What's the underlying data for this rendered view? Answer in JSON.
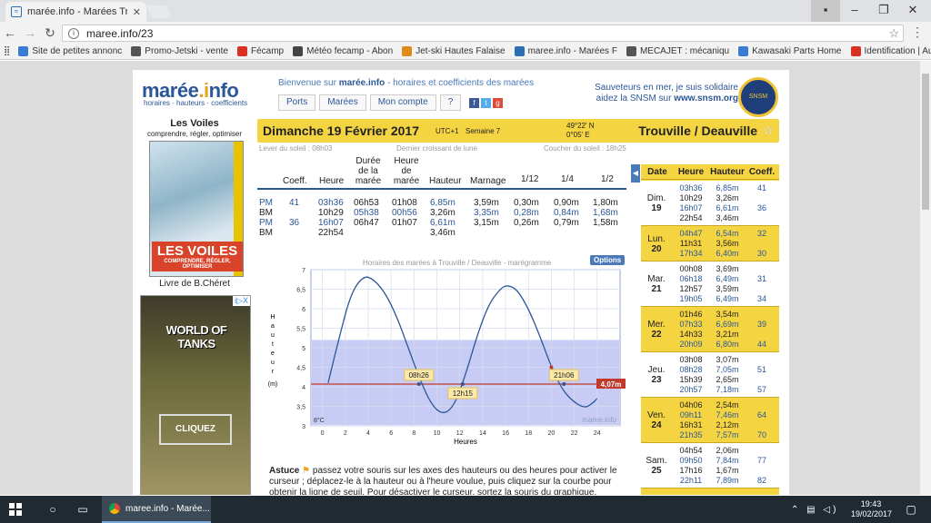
{
  "browser": {
    "tab_title": "marée.info - Marées Trou",
    "url": "maree.info/23",
    "bookmarks": [
      {
        "label": "Site de petites annonc",
        "color": "#3a7bd5"
      },
      {
        "label": "Promo-Jetski - vente",
        "color": "#555"
      },
      {
        "label": "Fécamp",
        "color": "#d93025"
      },
      {
        "label": "Météo fecamp - Abon",
        "color": "#444"
      },
      {
        "label": "Jet-ski Hautes Falaise",
        "color": "#e08a1a"
      },
      {
        "label": "maree.info - Marées F",
        "color": "#2a6fb4"
      },
      {
        "label": "MECAJET : mécaniqu",
        "color": "#555"
      },
      {
        "label": "Kawasaki Parts Home",
        "color": "#3a7bd5"
      },
      {
        "label": "Identification | Autoco",
        "color": "#d93025"
      }
    ]
  },
  "site": {
    "logo_main": "marée",
    "logo_dot": ".",
    "logo_i": "i",
    "logo_rest": "nfo",
    "logo_sub": "horaires · hauteurs · coefficients",
    "welcome_prefix": "Bienvenue sur ",
    "welcome_brand": "marée.info",
    "welcome_suffix": " - horaires et coefficients des marées",
    "nav": [
      "Ports",
      "Marées",
      "Mon compte",
      "?"
    ],
    "snsm_line1": "Sauveteurs en mer, je suis solidaire",
    "snsm_line2_prefix": "aidez la SNSM sur ",
    "snsm_link": "www.snsm.org",
    "snsm_badge": "SNSM"
  },
  "sidebar": {
    "title": "Les Voiles",
    "subtitle": "comprendre, régler, optimiser",
    "book_title": "LES VOILES",
    "book_sub": "COMPRENDRE, RÉGLER, OPTIMISER",
    "book_caption": "Livre de B.Chéret",
    "ad_title": "WORLD OF TANKS",
    "ad_button": "CLIQUEZ",
    "ad_tag": "i▷X"
  },
  "header": {
    "date": "Dimanche 19 Février 2017",
    "utc": "UTC+1",
    "week": "Semaine 7",
    "lat": "49°22' N",
    "lon": "0°05' E",
    "city": "Trouville / Deauville",
    "sunrise": "Lever du soleil : 08h03",
    "moon": "Dernier croissant de lune",
    "sunset": "Coucher du soleil : 18h25"
  },
  "tide_table": {
    "headers": [
      "Coeff.",
      "Heure",
      "Durée de la marée",
      "Heure de marée",
      "Hauteur",
      "Marnage",
      "1/12",
      "1/4",
      "1/2"
    ],
    "rows": [
      {
        "type": "PM",
        "coeff": "41",
        "heure": "03h36",
        "duree": "06h53",
        "heure_maree": "01h08",
        "hauteur": "6,85m",
        "marnage": "3,59m",
        "d12": "0,30m",
        "q": "0,90m",
        "h": "1,80m"
      },
      {
        "type": "BM",
        "coeff": "",
        "heure": "10h29",
        "duree": "05h38",
        "heure_maree": "00h56",
        "hauteur": "3,26m",
        "marnage": "3,35m",
        "d12": "0,28m",
        "q": "0,84m",
        "h": "1,68m"
      },
      {
        "type": "PM",
        "coeff": "36",
        "heure": "16h07",
        "duree": "06h47",
        "heure_maree": "01h07",
        "hauteur": "6,61m",
        "marnage": "3,15m",
        "d12": "0,26m",
        "q": "0,79m",
        "h": "1,58m"
      },
      {
        "type": "BM",
        "coeff": "",
        "heure": "22h54",
        "duree": "",
        "heure_maree": "",
        "hauteur": "3,46m",
        "marnage": "",
        "d12": "",
        "q": "",
        "h": ""
      }
    ]
  },
  "chart_title": "Horaires des marées à Trouville / Deauville - marégramme",
  "options_label": "Options",
  "chart_data": {
    "type": "line",
    "x": [
      0.5,
      1.5,
      2.5,
      3.6,
      4.5,
      5.5,
      6.5,
      7.5,
      8.5,
      9.5,
      10.5,
      11.5,
      12.5,
      13.5,
      14.5,
      15.5,
      16.1,
      17,
      18,
      19,
      20,
      21,
      22,
      22.9,
      23.5,
      24
    ],
    "y": [
      4.1,
      5.3,
      6.4,
      6.85,
      6.75,
      6.4,
      5.8,
      5.0,
      4.2,
      3.55,
      3.28,
      3.5,
      4.3,
      5.3,
      6.1,
      6.5,
      6.61,
      6.5,
      6.0,
      5.3,
      4.5,
      3.9,
      3.6,
      3.46,
      3.55,
      3.7
    ],
    "xlabel": "Heures",
    "ylabel": "Hauteur (m)",
    "xlim": [
      -1,
      26
    ],
    "ylim": [
      3,
      7
    ],
    "xticks": [
      0,
      2,
      4,
      6,
      8,
      10,
      12,
      14,
      16,
      18,
      20,
      22,
      24
    ],
    "yticks": [
      3,
      3.5,
      4,
      4.5,
      5,
      5.5,
      6,
      6.5,
      7
    ],
    "threshold": 4.07,
    "threshold_label": "4,07m",
    "shade_top": 5.2,
    "crossings": [
      {
        "x": 8.43,
        "label": "08h26"
      },
      {
        "x": 12.25,
        "label": "12h15"
      },
      {
        "x": 21.1,
        "label": "21h06"
      }
    ],
    "marker_x": 20,
    "temp_label": "8°C",
    "watermark": "maree.info",
    "line_color": "#2b5797",
    "shade_color": "#c8ccf4",
    "threshold_color": "#c0392b"
  },
  "astuce": {
    "label": "Astuce",
    "text": " passez votre souris sur les axes des hauteurs ou des heures pour activer le curseur ; déplacez-le à la hauteur ou à l'heure voulue, puis cliquez sur la courbe pour obtenir la ligne de seuil. Pour désactiver le curseur, sortez la souris du graphique."
  },
  "week_table": {
    "headers": [
      "Date",
      "Heure",
      "Hauteur",
      "Coeff."
    ],
    "days": [
      {
        "dow": "Dim.",
        "num": "19",
        "highlight": false,
        "tides": [
          [
            "03h36",
            "6,85m",
            "41",
            true
          ],
          [
            "10h29",
            "3,26m",
            "",
            false
          ],
          [
            "16h07",
            "6,61m",
            "36",
            true
          ],
          [
            "22h54",
            "3,46m",
            "",
            false
          ]
        ]
      },
      {
        "dow": "Lun.",
        "num": "20",
        "highlight": true,
        "tides": [
          [
            "04h47",
            "6,54m",
            "32",
            true
          ],
          [
            "11h31",
            "3,56m",
            "",
            false
          ],
          [
            "17h34",
            "6,40m",
            "30",
            true
          ]
        ]
      },
      {
        "dow": "Mar.",
        "num": "21",
        "highlight": false,
        "tides": [
          [
            "00h08",
            "3,69m",
            "",
            false
          ],
          [
            "06h18",
            "6,49m",
            "31",
            true
          ],
          [
            "12h57",
            "3,59m",
            "",
            false
          ],
          [
            "19h05",
            "6,49m",
            "34",
            true
          ]
        ]
      },
      {
        "dow": "Mer.",
        "num": "22",
        "highlight": true,
        "tides": [
          [
            "01h46",
            "3,54m",
            "",
            false
          ],
          [
            "07h33",
            "6,69m",
            "39",
            true
          ],
          [
            "14h33",
            "3,21m",
            "",
            false
          ],
          [
            "20h09",
            "6,80m",
            "44",
            true
          ]
        ]
      },
      {
        "dow": "Jeu.",
        "num": "23",
        "highlight": false,
        "tides": [
          [
            "03h08",
            "3,07m",
            "",
            false
          ],
          [
            "08h28",
            "7,05m",
            "51",
            true
          ],
          [
            "15h39",
            "2,65m",
            "",
            false
          ],
          [
            "20h57",
            "7,18m",
            "57",
            true
          ]
        ]
      },
      {
        "dow": "Ven.",
        "num": "24",
        "highlight": true,
        "tides": [
          [
            "04h06",
            "2,54m",
            "",
            false
          ],
          [
            "09h11",
            "7,46m",
            "64",
            true
          ],
          [
            "16h31",
            "2,12m",
            "",
            false
          ],
          [
            "21h35",
            "7,57m",
            "70",
            true
          ]
        ]
      },
      {
        "dow": "Sam.",
        "num": "25",
        "highlight": false,
        "tides": [
          [
            "04h54",
            "2,06m",
            "",
            false
          ],
          [
            "09h50",
            "7,84m",
            "77",
            true
          ],
          [
            "17h16",
            "1,67m",
            "",
            false
          ],
          [
            "22h11",
            "7,89m",
            "82",
            true
          ]
        ]
      }
    ]
  },
  "taskbar": {
    "active_app": "maree.info - Marée...",
    "time": "19:43",
    "date": "19/02/2017"
  }
}
